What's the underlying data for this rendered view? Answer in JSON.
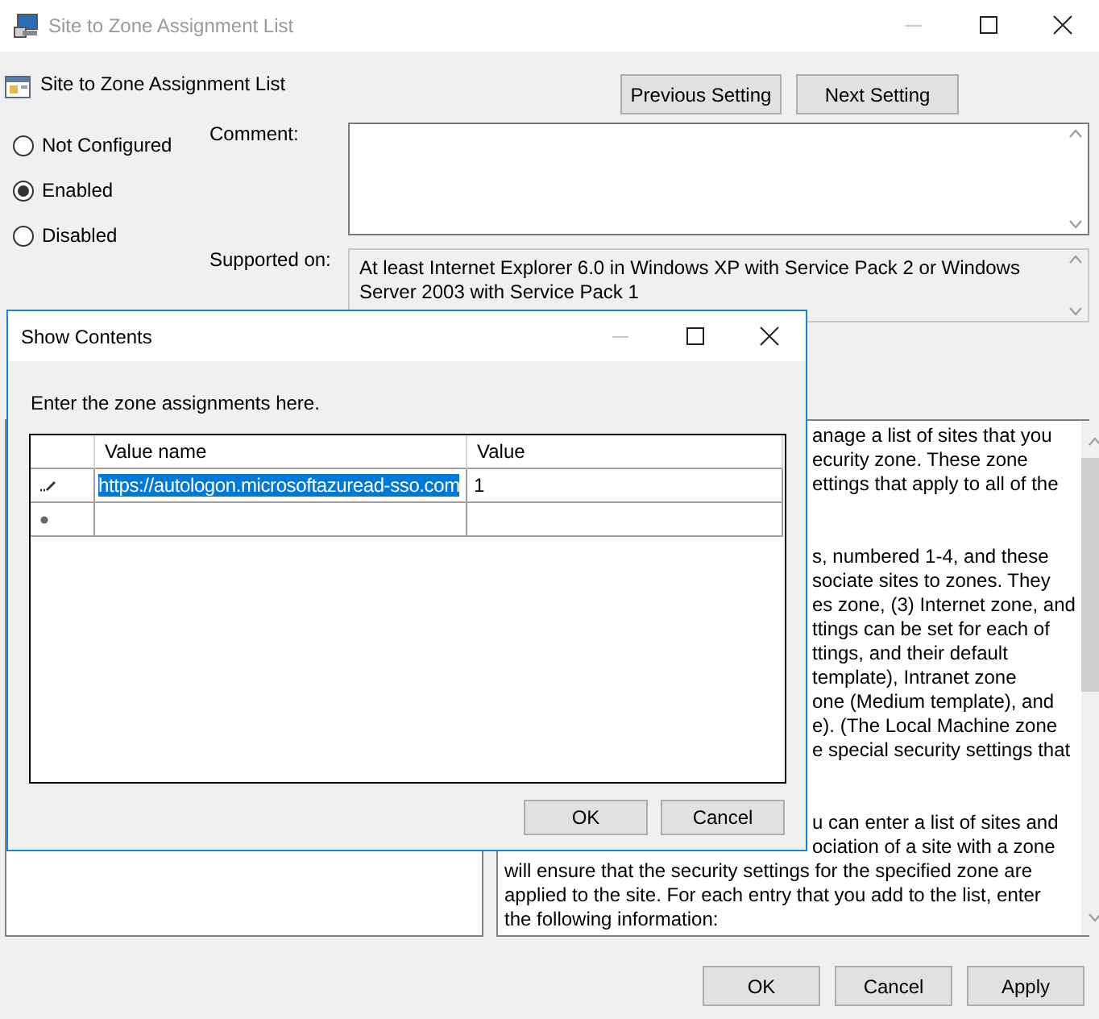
{
  "window": {
    "title": "Site to Zone Assignment List"
  },
  "policy": {
    "title": "Site to Zone Assignment List"
  },
  "nav_buttons": [
    "Previous Setting",
    "Next Setting"
  ],
  "state_options": [
    {
      "label": "Not Configured",
      "selected": false
    },
    {
      "label": "Enabled",
      "selected": true
    },
    {
      "label": "Disabled",
      "selected": false
    }
  ],
  "comment": {
    "label": "Comment:"
  },
  "supported_on": {
    "label": "Supported on:",
    "text": "At least Internet Explorer 6.0 in Windows XP with Service Pack 2 or Windows Server 2003 with Service Pack 1"
  },
  "help_paragraphs": [
    [
      {
        "text": "anage a list of sites that you",
        "covered": true
      },
      {
        "text": "ecurity zone. These zone",
        "covered": true
      },
      {
        "text": "ettings that apply to all of the",
        "covered": true
      }
    ],
    [
      {
        "text": "s, numbered 1-4, and these",
        "covered": true
      },
      {
        "text": "sociate sites to zones. They",
        "covered": true
      },
      {
        "text": "es zone, (3) Internet zone, and",
        "covered": true
      },
      {
        "text": "ttings can be set for each of",
        "covered": true
      },
      {
        "text": "ttings, and their default",
        "covered": true
      },
      {
        "text": "template), Intranet zone",
        "covered": true
      },
      {
        "text": "one (Medium template), and",
        "covered": true
      },
      {
        "text": "e). (The Local Machine zone",
        "covered": true
      },
      {
        "text": "e special security settings that",
        "covered": true
      }
    ],
    [
      {
        "text": "u can enter a list of sites and",
        "covered": true
      },
      {
        "text": "ociation of a site with a zone",
        "covered": true
      },
      {
        "text": "will ensure that the security settings for the specified zone are",
        "covered": false
      },
      {
        "text": "applied to the site.  For each entry that you add to the list, enter",
        "covered": false
      },
      {
        "text": "the following information:",
        "covered": false
      }
    ]
  ],
  "footer_buttons": [
    "OK",
    "Cancel",
    "Apply"
  ],
  "dialog": {
    "title": "Show Contents",
    "prompt": "Enter the zone assignments here.",
    "columns": [
      "Value name",
      "Value"
    ],
    "rows": [
      {
        "kind": "edit",
        "value_name": "https://autologon.microsoftazuread-sso.com",
        "value": "1",
        "highlighted": true
      },
      {
        "kind": "new"
      }
    ],
    "buttons": [
      "OK",
      "Cancel"
    ]
  }
}
